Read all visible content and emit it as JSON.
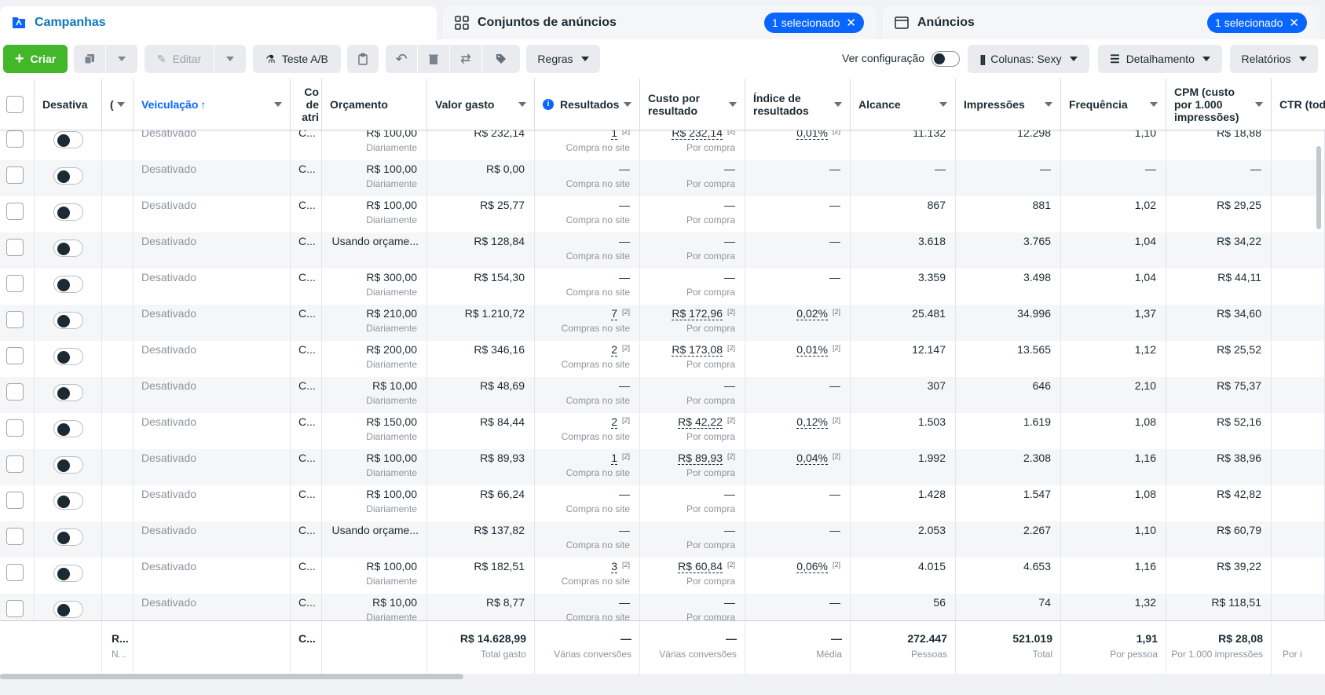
{
  "tabs": {
    "campaigns": "Campanhas",
    "adsets": "Conjuntos de anúncios",
    "adsets_selected": "1 selecionado",
    "ads": "Anúncios",
    "ads_selected": "1 selecionado"
  },
  "toolbar": {
    "create": "Criar",
    "edit": "Editar",
    "ab_test": "Teste A/B",
    "rules": "Regras",
    "view_config": "Ver configuração",
    "columns": "Colunas: Sexy",
    "breakdown": "Detalhamento",
    "reports": "Relatórios"
  },
  "columns": {
    "off": "Desativa",
    "c2": "(",
    "delivery": "Veiculação",
    "attr": "Co de atri",
    "budget": "Orçamento",
    "spent": "Valor gasto",
    "results": "Resultados",
    "cost": "Custo por resultado",
    "rate": "Índice de resultados",
    "reach": "Alcance",
    "impr": "Impressões",
    "freq": "Frequência",
    "cpm": "CPM (custo por 1.000 impressões)",
    "ctr": "CTR (todo"
  },
  "rows": [
    {
      "status": "Desativado",
      "attr": "C...",
      "budget": "R$ 100,00",
      "budget_sub": "Diariamente",
      "spent": "R$ 232,14",
      "results": "1",
      "results_fn": "[2]",
      "results_sub": "Compra no site",
      "cost": "R$ 232,14",
      "cost_fn": "[2]",
      "cost_sub": "Por compra",
      "rate": "0,01%",
      "rate_fn": "[2]",
      "reach": "11.132",
      "impr": "12.298",
      "freq": "1,10",
      "cpm": "R$ 18,88"
    },
    {
      "status": "Desativado",
      "attr": "C...",
      "budget": "R$ 100,00",
      "budget_sub": "Diariamente",
      "spent": "R$ 0,00",
      "results": "—",
      "results_fn": "",
      "results_sub": "Compra no site",
      "cost": "—",
      "cost_fn": "",
      "cost_sub": "Por compra",
      "rate": "—",
      "rate_fn": "",
      "reach": "—",
      "impr": "—",
      "freq": "—",
      "cpm": "—"
    },
    {
      "status": "Desativado",
      "attr": "C...",
      "budget": "R$ 100,00",
      "budget_sub": "Diariamente",
      "spent": "R$ 25,77",
      "results": "—",
      "results_fn": "",
      "results_sub": "Compra no site",
      "cost": "—",
      "cost_fn": "",
      "cost_sub": "Por compra",
      "rate": "—",
      "rate_fn": "",
      "reach": "867",
      "impr": "881",
      "freq": "1,02",
      "cpm": "R$ 29,25"
    },
    {
      "status": "Desativado",
      "attr": "C...",
      "budget": "Usando orçame...",
      "budget_sub": "",
      "spent": "R$ 128,84",
      "results": "—",
      "results_fn": "",
      "results_sub": "Compra no site",
      "cost": "—",
      "cost_fn": "",
      "cost_sub": "Por compra",
      "rate": "—",
      "rate_fn": "",
      "reach": "3.618",
      "impr": "3.765",
      "freq": "1,04",
      "cpm": "R$ 34,22"
    },
    {
      "status": "Desativado",
      "attr": "C...",
      "budget": "R$ 300,00",
      "budget_sub": "Diariamente",
      "spent": "R$ 154,30",
      "results": "—",
      "results_fn": "",
      "results_sub": "Compra no site",
      "cost": "—",
      "cost_fn": "",
      "cost_sub": "Por compra",
      "rate": "—",
      "rate_fn": "",
      "reach": "3.359",
      "impr": "3.498",
      "freq": "1,04",
      "cpm": "R$ 44,11"
    },
    {
      "status": "Desativado",
      "attr": "C...",
      "budget": "R$ 210,00",
      "budget_sub": "Diariamente",
      "spent": "R$ 1.210,72",
      "results": "7",
      "results_fn": "[2]",
      "results_sub": "Compras no site",
      "cost": "R$ 172,96",
      "cost_fn": "[2]",
      "cost_sub": "Por compra",
      "rate": "0,02%",
      "rate_fn": "[2]",
      "reach": "25.481",
      "impr": "34.996",
      "freq": "1,37",
      "cpm": "R$ 34,60"
    },
    {
      "status": "Desativado",
      "attr": "C...",
      "budget": "R$ 200,00",
      "budget_sub": "Diariamente",
      "spent": "R$ 346,16",
      "results": "2",
      "results_fn": "[2]",
      "results_sub": "Compras no site",
      "cost": "R$ 173,08",
      "cost_fn": "[2]",
      "cost_sub": "Por compra",
      "rate": "0,01%",
      "rate_fn": "[2]",
      "reach": "12.147",
      "impr": "13.565",
      "freq": "1,12",
      "cpm": "R$ 25,52"
    },
    {
      "status": "Desativado",
      "attr": "C...",
      "budget": "R$ 10,00",
      "budget_sub": "Diariamente",
      "spent": "R$ 48,69",
      "results": "—",
      "results_fn": "",
      "results_sub": "Compra no site",
      "cost": "—",
      "cost_fn": "",
      "cost_sub": "Por compra",
      "rate": "—",
      "rate_fn": "",
      "reach": "307",
      "impr": "646",
      "freq": "2,10",
      "cpm": "R$ 75,37"
    },
    {
      "status": "Desativado",
      "attr": "C...",
      "budget": "R$ 150,00",
      "budget_sub": "Diariamente",
      "spent": "R$ 84,44",
      "results": "2",
      "results_fn": "[2]",
      "results_sub": "Compras no site",
      "cost": "R$ 42,22",
      "cost_fn": "[2]",
      "cost_sub": "Por compra",
      "rate": "0,12%",
      "rate_fn": "[2]",
      "reach": "1.503",
      "impr": "1.619",
      "freq": "1,08",
      "cpm": "R$ 52,16"
    },
    {
      "status": "Desativado",
      "attr": "C...",
      "budget": "R$ 100,00",
      "budget_sub": "Diariamente",
      "spent": "R$ 89,93",
      "results": "1",
      "results_fn": "[2]",
      "results_sub": "Compra no site",
      "cost": "R$ 89,93",
      "cost_fn": "[2]",
      "cost_sub": "Por compra",
      "rate": "0,04%",
      "rate_fn": "[2]",
      "reach": "1.992",
      "impr": "2.308",
      "freq": "1,16",
      "cpm": "R$ 38,96"
    },
    {
      "status": "Desativado",
      "attr": "C...",
      "budget": "R$ 100,00",
      "budget_sub": "Diariamente",
      "spent": "R$ 66,24",
      "results": "—",
      "results_fn": "",
      "results_sub": "Compra no site",
      "cost": "—",
      "cost_fn": "",
      "cost_sub": "Por compra",
      "rate": "—",
      "rate_fn": "",
      "reach": "1.428",
      "impr": "1.547",
      "freq": "1,08",
      "cpm": "R$ 42,82"
    },
    {
      "status": "Desativado",
      "attr": "C...",
      "budget": "Usando orçame...",
      "budget_sub": "",
      "spent": "R$ 137,82",
      "results": "—",
      "results_fn": "",
      "results_sub": "Compra no site",
      "cost": "—",
      "cost_fn": "",
      "cost_sub": "Por compra",
      "rate": "—",
      "rate_fn": "",
      "reach": "2.053",
      "impr": "2.267",
      "freq": "1,10",
      "cpm": "R$ 60,79"
    },
    {
      "status": "Desativado",
      "attr": "C...",
      "budget": "R$ 100,00",
      "budget_sub": "Diariamente",
      "spent": "R$ 182,51",
      "results": "3",
      "results_fn": "[2]",
      "results_sub": "Compras no site",
      "cost": "R$ 60,84",
      "cost_fn": "[2]",
      "cost_sub": "Por compra",
      "rate": "0,06%",
      "rate_fn": "[2]",
      "reach": "4.015",
      "impr": "4.653",
      "freq": "1,16",
      "cpm": "R$ 39,22"
    },
    {
      "status": "Desativado",
      "attr": "C...",
      "budget": "R$ 10,00",
      "budget_sub": "Diariamente",
      "spent": "R$ 8,77",
      "results": "—",
      "results_fn": "",
      "results_sub": "Compra no site",
      "cost": "—",
      "cost_fn": "",
      "cost_sub": "Por compra",
      "rate": "—",
      "rate_fn": "",
      "reach": "56",
      "impr": "74",
      "freq": "1,32",
      "cpm": "R$ 118,51"
    }
  ],
  "totals": {
    "name": "R...",
    "name_sub": "N...",
    "attr": "C...",
    "spent": "R$ 14.628,99",
    "spent_sub": "Total gasto",
    "results": "—",
    "results_sub": "Várias conversões",
    "cost": "—",
    "cost_sub": "Várias conversões",
    "rate": "—",
    "rate_sub": "Média",
    "reach": "272.447",
    "reach_sub": "Pessoas",
    "impr": "521.019",
    "impr_sub": "Total",
    "freq": "1,91",
    "freq_sub": "Por pessoa",
    "cpm": "R$ 28,08",
    "cpm_sub": "Por 1.000 impressões",
    "ctr_sub": "Por i"
  }
}
